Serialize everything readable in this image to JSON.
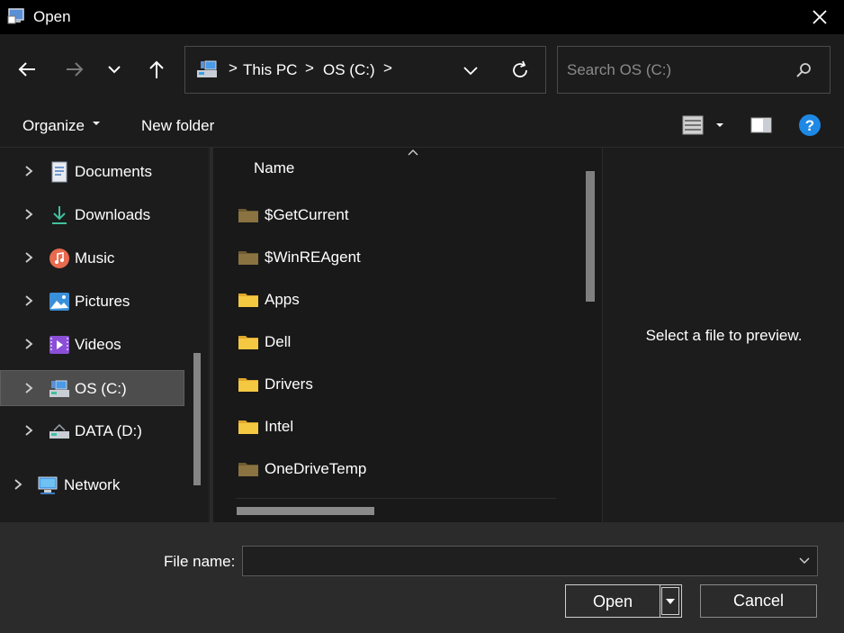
{
  "window": {
    "title": "Open",
    "close_icon": "close-icon"
  },
  "nav": {
    "back_icon": "arrow-left-icon",
    "forward_icon": "arrow-right-icon",
    "recent_icon": "chevron-down-icon",
    "up_icon": "arrow-up-icon"
  },
  "address": {
    "icon": "this-pc-icon",
    "crumbs": [
      "This PC",
      "OS (C:)"
    ],
    "separator": ">"
  },
  "search": {
    "placeholder": "Search OS (C:)",
    "value": ""
  },
  "toolbar": {
    "organize_label": "Organize",
    "new_folder_label": "New folder",
    "view_icon": "list-view-icon",
    "preview_pane_icon": "preview-pane-icon",
    "help_icon": "help-icon"
  },
  "sidebar": {
    "items": [
      {
        "label": "Documents",
        "icon": "documents-icon"
      },
      {
        "label": "Downloads",
        "icon": "downloads-icon"
      },
      {
        "label": "Music",
        "icon": "music-icon"
      },
      {
        "label": "Pictures",
        "icon": "pictures-icon"
      },
      {
        "label": "Videos",
        "icon": "videos-icon"
      },
      {
        "label": "OS (C:)",
        "icon": "drive-c-icon",
        "selected": true
      },
      {
        "label": "DATA (D:)",
        "icon": "drive-d-icon"
      },
      {
        "label": "Network",
        "icon": "network-icon"
      }
    ]
  },
  "files": {
    "column_name": "Name",
    "rows": [
      {
        "name": "$GetCurrent",
        "hidden": true
      },
      {
        "name": "$WinREAgent",
        "hidden": true
      },
      {
        "name": "Apps",
        "hidden": false
      },
      {
        "name": "Dell",
        "hidden": false
      },
      {
        "name": "Drivers",
        "hidden": false
      },
      {
        "name": "Intel",
        "hidden": false
      },
      {
        "name": "OneDriveTemp",
        "hidden": true
      }
    ]
  },
  "preview": {
    "message": "Select a file to preview."
  },
  "footer": {
    "file_name_label": "File name:",
    "file_name_value": "",
    "open_label": "Open",
    "cancel_label": "Cancel"
  },
  "colors": {
    "folder": "#f5c842",
    "folder_hidden": "#8a7340",
    "help": "#1e88e5",
    "downloads": "#3fc1a0"
  }
}
